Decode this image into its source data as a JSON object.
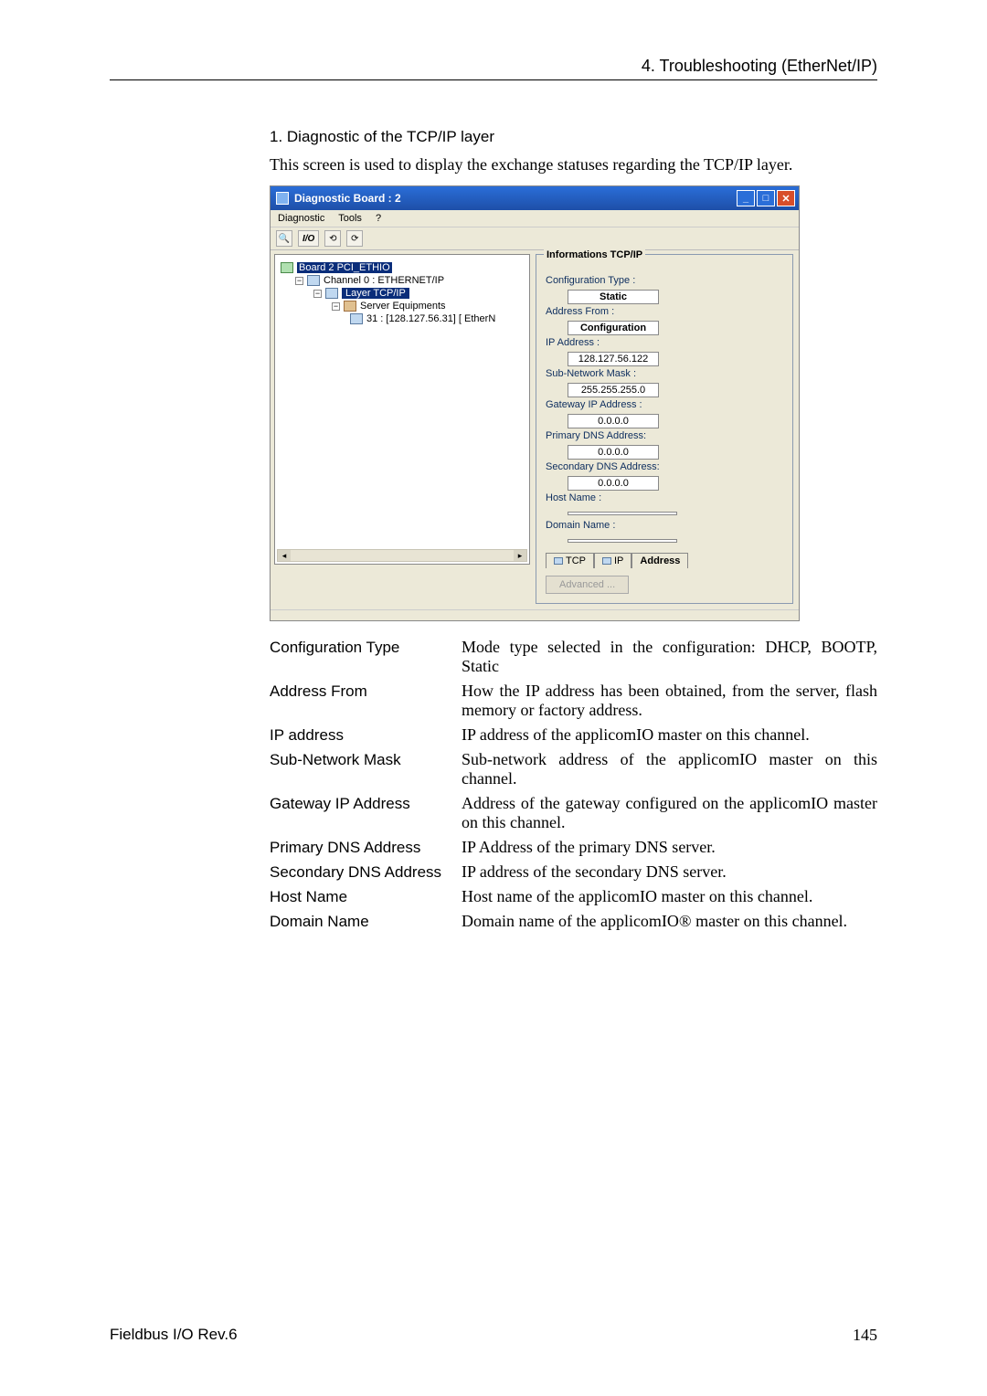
{
  "page_header": "4. Troubleshooting (EtherNet/IP)",
  "section_title": "1. Diagnostic of the TCP/IP layer",
  "intro_text": "This screen is used to display the exchange statuses regarding the TCP/IP layer.",
  "window": {
    "title": "Diagnostic Board : 2",
    "menu": {
      "diagnostic": "Diagnostic",
      "tools": "Tools",
      "help": "?"
    },
    "toolbar": {
      "zoom_glyph": "🔍",
      "io_label": "I/O",
      "refresh1": "⟲",
      "refresh2": "⟳"
    },
    "tree": {
      "board": "Board 2 PCI_ETHIO",
      "channel": "Channel 0 : ETHERNET/IP",
      "layer": "Layer TCP/IP",
      "server_equip": "Server Equipments",
      "server_node": "31 : [128.127.56.31] [ EtherN"
    },
    "info": {
      "legend": "Informations TCP/IP",
      "config_type_label": "Configuration Type :",
      "config_type_value": "Static",
      "address_from_label": "Address From :",
      "address_from_value": "Configuration",
      "ip_label": "IP Address :",
      "ip_value": "128.127.56.122",
      "subnet_label": "Sub-Network Mask :",
      "subnet_value": "255.255.255.0",
      "gateway_label": "Gateway IP Address :",
      "gateway_value": "0.0.0.0",
      "primary_dns_label": "Primary DNS Address:",
      "primary_dns_value": "0.0.0.0",
      "secondary_dns_label": "Secondary DNS Address:",
      "secondary_dns_value": "0.0.0.0",
      "host_name_label": "Host Name :",
      "host_name_value": "",
      "domain_name_label": "Domain Name :",
      "domain_name_value": "",
      "tab_tcp": "TCP",
      "tab_ip": "IP",
      "tab_address": "Address",
      "advanced_btn": "Advanced ..."
    }
  },
  "definitions": [
    {
      "term": "Configuration Type",
      "desc": "Mode type selected in the configuration: DHCP, BOOTP, Static"
    },
    {
      "term": "Address From",
      "desc": "How the IP address has been obtained, from the server, flash memory or factory address."
    },
    {
      "term": "IP address",
      "desc": "IP address of the applicomIO master on this channel."
    },
    {
      "term": "Sub-Network Mask",
      "desc": "Sub-network address of the applicomIO master on this channel."
    },
    {
      "term": "Gateway IP Address",
      "desc": "Address of the gateway configured on the applicomIO master on this channel."
    },
    {
      "term": "Primary DNS Address",
      "desc": "IP Address of the primary DNS server."
    },
    {
      "term": "Secondary DNS Address",
      "desc": "IP address of the secondary DNS server."
    },
    {
      "term": "Host Name",
      "desc": "Host name of the applicomIO master on this channel."
    },
    {
      "term": "Domain Name",
      "desc": "Domain name of the applicomIO® master on this channel."
    }
  ],
  "footer": {
    "left": "Fieldbus I/O Rev.6",
    "right": "145"
  }
}
